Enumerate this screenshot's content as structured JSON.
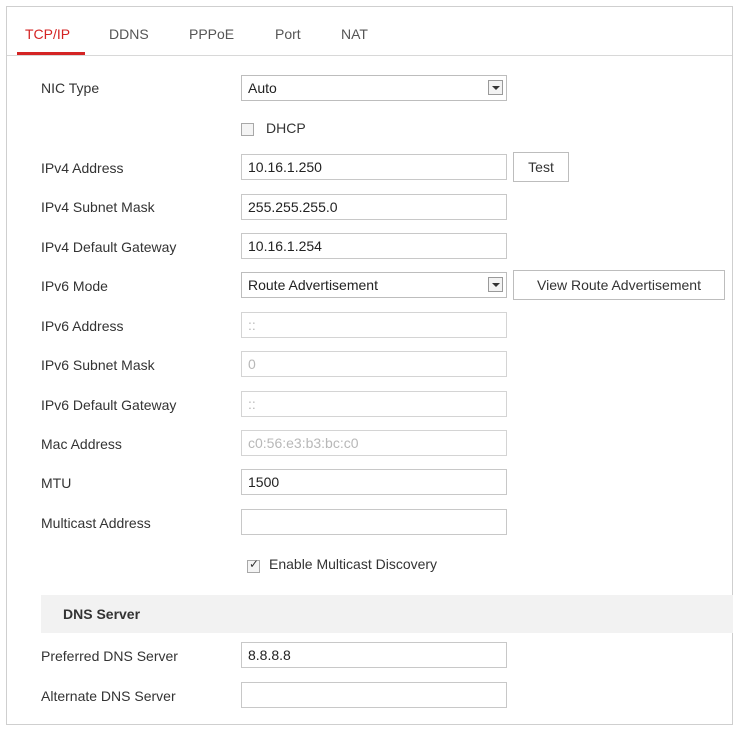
{
  "tabs": [
    {
      "label": "TCP/IP",
      "active": true
    },
    {
      "label": "DDNS"
    },
    {
      "label": "PPPoE"
    },
    {
      "label": "Port"
    },
    {
      "label": "NAT"
    }
  ],
  "colors": {
    "accent": "#d42424"
  },
  "form": {
    "nic_type": {
      "label": "NIC Type",
      "value": "Auto"
    },
    "dhcp": {
      "label": "DHCP",
      "checked": false
    },
    "ipv4_address": {
      "label": "IPv4 Address",
      "value": "10.16.1.250"
    },
    "test_button": "Test",
    "ipv4_subnet_mask": {
      "label": "IPv4 Subnet Mask",
      "value": "255.255.255.0"
    },
    "ipv4_default_gateway": {
      "label": "IPv4 Default Gateway",
      "value": "10.16.1.254"
    },
    "ipv6_mode": {
      "label": "IPv6 Mode",
      "value": "Route Advertisement"
    },
    "view_route_button": "View Route Advertisement",
    "ipv6_address": {
      "label": "IPv6 Address",
      "value": "::"
    },
    "ipv6_subnet_mask": {
      "label": "IPv6 Subnet Mask",
      "value": "0"
    },
    "ipv6_default_gateway": {
      "label": "IPv6 Default Gateway",
      "value": "::"
    },
    "mac_address": {
      "label": "Mac Address",
      "value": "c0:56:e3:b3:bc:c0"
    },
    "mtu": {
      "label": "MTU",
      "value": "1500"
    },
    "multicast_address": {
      "label": "Multicast Address",
      "value": ""
    },
    "multicast_discovery": {
      "label": "Enable Multicast Discovery",
      "checked": true
    }
  },
  "dns": {
    "section_title": "DNS Server",
    "preferred": {
      "label": "Preferred DNS Server",
      "value": "8.8.8.8"
    },
    "alternate": {
      "label": "Alternate DNS Server",
      "value": ""
    }
  }
}
